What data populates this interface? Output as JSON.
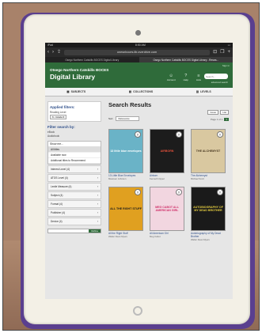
{
  "browser": {
    "status_left": "iPad",
    "status_time": "8:50 AM",
    "url": "onesnboces.lib.overdrive.com",
    "tabs": [
      "Osego Northern Catskills BOCES Digital Library",
      "Osego Northern Catskills BOCES Digital Library - Resea..."
    ]
  },
  "site": {
    "signin": "Sign in",
    "org_name": "Otsego Northern Catskills BOCES",
    "brand": "Digital Library",
    "links": [
      {
        "label": "Account",
        "icon": "person-icon"
      },
      {
        "label": "Help",
        "icon": "help-icon"
      },
      {
        "label": "Lists",
        "icon": "list-icon"
      }
    ],
    "search_placeholder": "Search...",
    "advanced_search": "advanced search"
  },
  "nav": [
    "SUBJECTS",
    "COLLECTIONS",
    "LEVELS"
  ],
  "sidebar": {
    "applied_title": "Applied filters:",
    "applied_label": "Reading Level",
    "applied_value": "6 - Grade 6",
    "filter_title": "Filter search by:",
    "filter_sub1": "eBook",
    "filter_sub2": "Audiobook",
    "show_me_label": "Show me...",
    "options": [
      "All titles",
      "Available now",
      "Additional titles to Recommend"
    ],
    "facets": [
      "Interest Level (4)",
      "ATOS Level (4)",
      "Lexile Measure (4)",
      "Subject (4)",
      "Format (4)",
      "Publisher (4)",
      "Device (4)"
    ],
    "go_label": "Refine"
  },
  "results": {
    "title": "Search Results",
    "sort_label": "Sort",
    "sort_value": "Relevance",
    "view_cover": "Cover",
    "view_list": "List",
    "pager_text": "Page 1 of 1",
    "pager_btn": "1",
    "books": [
      {
        "title": "13 Little Blue Envelopes",
        "author": "Maureen Johnson",
        "cover_text": "13 little blue envelopes",
        "bg": "#6ab3c7",
        "fg": "#ffffff"
      },
      {
        "title": "Airborn",
        "author": "Kenneth Oppel",
        "cover_text": "AIRBORN",
        "bg": "#1c1c1c",
        "fg": "#e3503a"
      },
      {
        "title": "The Alchemyst",
        "author": "Michael Scott",
        "cover_text": "THE ALCHEMYST",
        "bg": "#d9c8a0",
        "fg": "#4a3a22"
      },
      {
        "title": "All the Right Stuff",
        "author": "Walter Dean Myers",
        "cover_text": "ALL THE RIGHT STUFF",
        "bg": "#e0a020",
        "fg": "#1c1c1c"
      },
      {
        "title": "All American Girl",
        "author": "Meg Cabot",
        "cover_text": "MEG CABOT ALL AMERICAN GIRL",
        "bg": "#f2d6e0",
        "fg": "#d0306a"
      },
      {
        "title": "Autobiography of My Dead Brother",
        "author": "Walter Dean Myers",
        "cover_text": "AUTOBIOGRAPHY OF MY DEAD BROTHER",
        "bg": "#1a1a1a",
        "fg": "#e8d040"
      }
    ]
  }
}
